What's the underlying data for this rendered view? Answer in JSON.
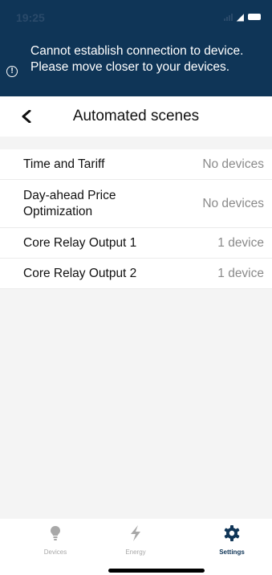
{
  "status_bar": {
    "time": "19:25"
  },
  "banner": {
    "message": "Cannot establish connection to device. Please move closer to your devices.",
    "icon": "alert-circle-icon",
    "background": "#0f3557"
  },
  "header": {
    "title": "Automated scenes",
    "back_icon": "chevron-left-icon"
  },
  "scenes": [
    {
      "name": "Time and Tariff",
      "count": "No devices"
    },
    {
      "name": "Day-ahead Price Optimization",
      "count": "No devices"
    },
    {
      "name": "Core Relay Output 1",
      "count": "1 device"
    },
    {
      "name": "Core Relay Output 2",
      "count": "1 device"
    }
  ],
  "tabbar": {
    "tabs": [
      {
        "label": "Devices",
        "icon": "lightbulb-icon",
        "active": false
      },
      {
        "label": "Energy",
        "icon": "lightning-icon",
        "active": false
      },
      {
        "label": "Settings",
        "icon": "gear-icon",
        "active": true
      }
    ],
    "active_color": "#0f3557",
    "inactive_color": "#a8a8a8"
  }
}
